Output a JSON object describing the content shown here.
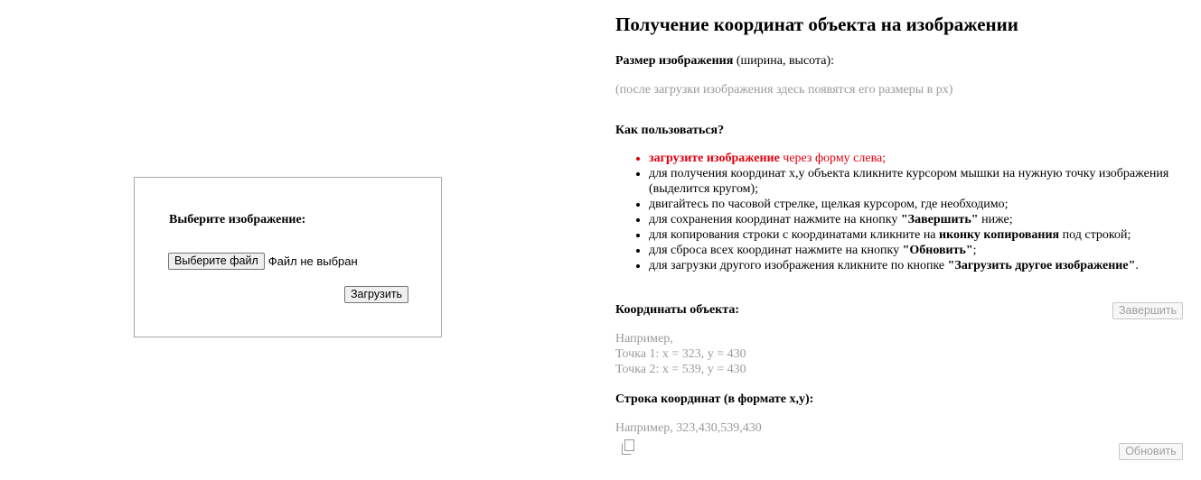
{
  "upload": {
    "title": "Выберите изображение:",
    "choose_file_label": "Выберите файл",
    "file_status": "Файл не выбран",
    "upload_label": "Загрузить"
  },
  "info": {
    "title": "Получение координат объекта на изображении",
    "size_label_bold": "Размер изображения",
    "size_label_rest": " (ширина, высота):",
    "size_hint": "(после загрузки изображения здесь появятся его размеры в px)",
    "howto_title": "Как пользоваться?",
    "steps": {
      "s1_bold": "загрузите изображение",
      "s1_rest": " через форму слева;",
      "s2": "для получения координат x,y объекта кликните курсором мышки на нужную точку изображения (выделится кругом);",
      "s3": "двигайтесь по часовой стрелке, щелкая курсором, где необходимо;",
      "s4_pre": "для сохранения координат нажмите на кнопку ",
      "s4_bold": "\"Завершить\"",
      "s4_post": " ниже;",
      "s5_pre": "для копирования строки с координатами кликните на ",
      "s5_bold": "иконку копирования",
      "s5_post": " под строкой;",
      "s6_pre": "для сброса всех координат нажмите на кнопку ",
      "s6_bold": "\"Обновить\"",
      "s6_post": ";",
      "s7_pre": "для загрузки другого изображения кликните по кнопке ",
      "s7_bold": "\"Загрузить другое изображение\"",
      "s7_post": "."
    },
    "coords_title": "Координаты объекта:",
    "finish_label": "Завершить",
    "example": {
      "line1": "Например,",
      "line2": "Точка 1: x = 323, y = 430",
      "line3": "Точка 2: x = 539, y = 430"
    },
    "coord_string_title": "Строка координат (в формате x,y):",
    "coord_string_example": "Например, 323,430,539,430",
    "refresh_label": "Обновить"
  },
  "colors": {
    "accent_red": "#e0000f",
    "hint_gray": "#9a9a9a",
    "box_border": "#a8a8a8"
  },
  "icons": {
    "copy": "copy-icon"
  }
}
